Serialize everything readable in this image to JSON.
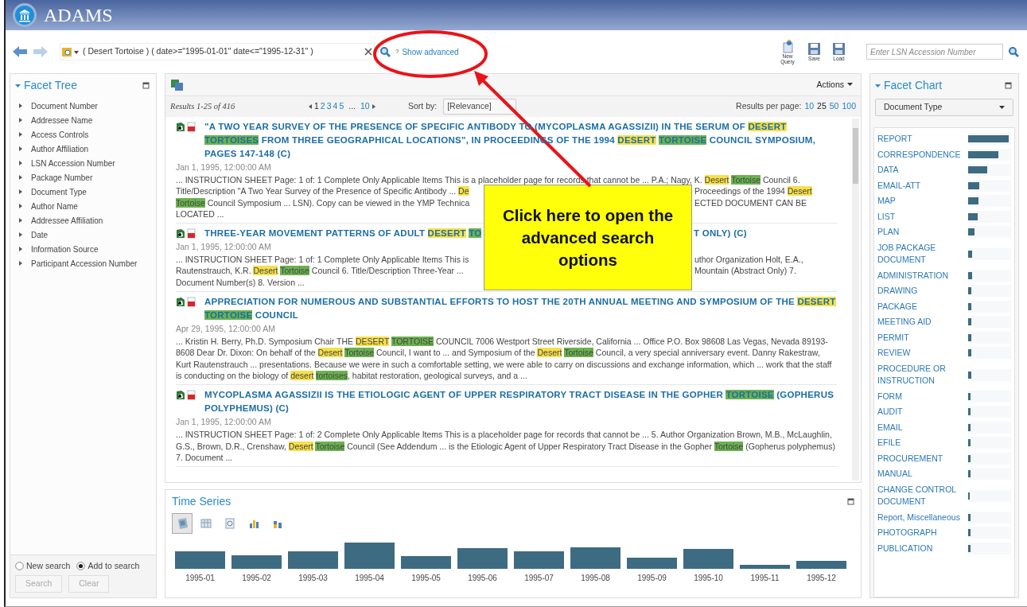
{
  "header": {
    "title": "ADAMS"
  },
  "toolbar": {
    "back_disabled": false,
    "forward_disabled": true,
    "query": "( Desert Tortoise ) ( date>=\"1995-01-01\" date<=\"1995-12-31\" )",
    "help": "?",
    "advanced_link": "Show advanced",
    "tools": [
      {
        "label": "New Query",
        "kind": "new"
      },
      {
        "label": "Save",
        "kind": "save"
      },
      {
        "label": "Load",
        "kind": "load"
      }
    ],
    "lsn_placeholder": "Enter LSN Accession Number"
  },
  "facet_tree": {
    "title": "Facet Tree",
    "items": [
      "Document Number",
      "Addressee Name",
      "Access Controls",
      "Author Affiliation",
      "LSN Accession Number",
      "Package Number",
      "Document Type",
      "Author Name",
      "Addressee Affiliation",
      "Date",
      "Information Source",
      "Participant Accession Number"
    ],
    "modes": [
      {
        "label": "New search",
        "selected": false
      },
      {
        "label": "Add to search",
        "selected": true
      }
    ],
    "buttons": [
      {
        "label": "Search",
        "disabled": true
      },
      {
        "label": "Clear",
        "disabled": true
      }
    ]
  },
  "results": {
    "actions": "Actions",
    "summary": "Results 1-25 of 416",
    "pages": [
      {
        "label": "1",
        "selected": true
      },
      {
        "label": "2",
        "selected": false
      },
      {
        "label": "3",
        "selected": false
      },
      {
        "label": "4",
        "selected": false
      },
      {
        "label": "5",
        "selected": false
      }
    ],
    "ellipsis": "...",
    "last_page": "10",
    "sort_label": "Sort by:",
    "sort_value": "[Relevance]",
    "per_page_label": "Results per page:",
    "per_page": [
      {
        "label": "10",
        "selected": false
      },
      {
        "label": "25",
        "selected": true
      },
      {
        "label": "50",
        "selected": false
      },
      {
        "label": "100",
        "selected": false
      }
    ],
    "items": [
      {
        "title": [
          [
            {
              "text": "\"A TWO YEAR SURVEY OF THE PRESENCE OF SPECIFIC ANTIBODY TO (MYCOPLASMA AGASSIZII) IN THE SERUM OF ",
              "kind": "plain"
            },
            {
              "text": "DESERT ",
              "kind": "term1"
            },
            {
              "text": "TORTOISES",
              "kind": "term2"
            },
            {
              "text": " FROM THREE GEOGRAPHICAL LOCATIONS\", IN PROCEEDINGS OF THE 1994 ",
              "kind": "plain"
            },
            {
              "text": "DESERT ",
              "kind": "term1"
            },
            {
              "text": "TORTOISE",
              "kind": "term2"
            },
            {
              "text": " COUNCIL SYMPOSIUM, PAGES 147-148 (C)",
              "kind": "plain"
            }
          ]
        ],
        "date": "Jan 1, 1995, 12:00:00 AM",
        "snippet": [
          [
            [
              {
                "text": "... INSTRUCTION SHEET Page: 1 of: 1 Complete Only Applicable Items This is a placeholder page for records that cannot be ... P.A.; Nagy, K. ",
                "kind": "plain"
              },
              {
                "text": "Desert ",
                "kind": "term1"
              },
              {
                "text": "Tortoise",
                "kind": "term2"
              },
              {
                "text": " Council 6.",
                "kind": "plain"
              }
            ]
          ],
          [
            [
              {
                "text": "Title/Description \"A Two Year Survey of the Presence of Specific Antibody ... ",
                "kind": "plain"
              },
              {
                "text": "De",
                "kind": "term1"
              }
            ],
            [
              {
                "text": "Proceedings of the 1994 ",
                "kind": "plain"
              },
              {
                "text": "Desert",
                "kind": "term1"
              }
            ]
          ],
          [
            [
              {
                "text": "Tortoise",
                "kind": "term2"
              },
              {
                "text": " Council Symposium ... LSN). Copy can be viewed in the YMP Technica",
                "kind": "plain"
              }
            ],
            [
              {
                "text": "ECTED DOCUMENT CAN BE",
                "kind": "plain"
              }
            ]
          ],
          [
            [
              {
                "text": "LOCATED ...",
                "kind": "plain"
              }
            ]
          ]
        ]
      },
      {
        "title": [
          [
            {
              "text": "THREE-YEAR MOVEMENT PATTERNS OF ADULT ",
              "kind": "plain"
            },
            {
              "text": "DESERT ",
              "kind": "term1"
            },
            {
              "text": "TO",
              "kind": "term2"
            }
          ],
          [
            {
              "text": "T ONLY) (C)",
              "kind": "plain"
            }
          ]
        ],
        "date": "Jan 1, 1995, 12:00:00 AM",
        "snippet": [
          [
            [
              {
                "text": "... INSTRUCTION SHEET Page: 1 of: 1 Complete Only Applicable Items This is",
                "kind": "plain"
              }
            ],
            [
              {
                "text": "uthor Organization Holt, E.A.,",
                "kind": "plain"
              }
            ]
          ],
          [
            [
              {
                "text": "Rautenstrauch, K.R. ",
                "kind": "plain"
              },
              {
                "text": "Desert ",
                "kind": "term1"
              },
              {
                "text": "Tortoise",
                "kind": "term2"
              },
              {
                "text": " Council 6. Title/Description Three-Year ...",
                "kind": "plain"
              }
            ],
            [
              {
                "text": "Mountain (Abstract Only) 7.",
                "kind": "plain"
              }
            ]
          ],
          [
            [
              {
                "text": "Document Number(s) 8. Version ...",
                "kind": "plain"
              }
            ]
          ]
        ]
      },
      {
        "title": [
          [
            {
              "text": "APPRECIATION FOR NUMEROUS AND SUBSTANTIAL EFFORTS TO HOST THE 20TH ANNUAL MEETING AND SYMPOSIUM OF THE ",
              "kind": "plain"
            },
            {
              "text": "DESERT ",
              "kind": "term1"
            },
            {
              "text": "TORTOISE",
              "kind": "term2"
            },
            {
              "text": " COUNCIL",
              "kind": "plain"
            }
          ]
        ],
        "date": "Apr 29, 1995, 12:00:00 AM",
        "snippet": [
          [
            [
              {
                "text": "... Kristin H. Berry, Ph.D. Symposium Chair THE ",
                "kind": "plain"
              },
              {
                "text": "DESERT ",
                "kind": "term1"
              },
              {
                "text": "TORTOISE",
                "kind": "term2"
              },
              {
                "text": " COUNCIL 7006 Westport Street Riverside, California ... Office P.O. Box 98608 Las Vegas, Nevada 89193-8608 Dear Dr. Dixon: On behalf of the ",
                "kind": "plain"
              },
              {
                "text": "Desert ",
                "kind": "term1"
              },
              {
                "text": "Tortoise",
                "kind": "term2"
              },
              {
                "text": " Council, I want to ... and Symposium of the ",
                "kind": "plain"
              },
              {
                "text": "Desert ",
                "kind": "term1"
              },
              {
                "text": "Tortoise",
                "kind": "term2"
              },
              {
                "text": " Council, a very special anniversary event. Danny Rakestraw, Kurt Rautenstrauch ... presentations. Because we were in such a comfortable setting, we were able to carry on discussions and exchange information, which ... work that the staff is conducting on the biology of ",
                "kind": "plain"
              },
              {
                "text": "desert ",
                "kind": "term1"
              },
              {
                "text": "tortoises",
                "kind": "term2"
              },
              {
                "text": ", habitat restoration, geological surveys, and a ...",
                "kind": "plain"
              }
            ]
          ]
        ]
      },
      {
        "title": [
          [
            {
              "text": "MYCOPLASMA AGASSIZII IS THE ETIOLOGIC AGENT OF UPPER RESPIRATORY TRACT DISEASE IN THE GOPHER ",
              "kind": "plain"
            },
            {
              "text": "TORTOISE",
              "kind": "term2"
            },
            {
              "text": " (GOPHERUS POLYPHEMUS) (C)",
              "kind": "plain"
            }
          ]
        ],
        "date": "Jan 1, 1995, 12:00:00 AM",
        "snippet": [
          [
            [
              {
                "text": "... INSTRUCTION SHEET Page: 1 of: 2 Complete Only Applicable Items This is a placeholder page for records that cannot be ... 5. Author Organization Brown, M.B., McLaughlin, G.S., Brown, D.R., Crenshaw, ",
                "kind": "plain"
              },
              {
                "text": "Desert ",
                "kind": "term1"
              },
              {
                "text": "Tortoise",
                "kind": "term2"
              },
              {
                "text": " Council (See Addendum ... is the Etiologic Agent of Upper Respiratory Tract Disease in the Gopher ",
                "kind": "plain"
              },
              {
                "text": "Tortoise",
                "kind": "term2"
              },
              {
                "text": " (Gopherus polyphemus) 7. Document ...",
                "kind": "plain"
              }
            ]
          ]
        ]
      }
    ]
  },
  "time_series": {
    "title": "Time Series",
    "views": [
      {
        "kind": "map",
        "selected": true
      },
      {
        "kind": "grid",
        "selected": false
      },
      {
        "kind": "page",
        "selected": false
      },
      {
        "kind": "bars",
        "selected": false
      },
      {
        "kind": "stacked",
        "selected": false
      }
    ],
    "labels": [
      "1995-01",
      "1995-02",
      "1995-03",
      "1995-04",
      "1995-05",
      "1995-06",
      "1995-07",
      "1995-08",
      "1995-09",
      "1995-10",
      "1995-11",
      "1995-12"
    ]
  },
  "facet_chart": {
    "title": "Facet Chart",
    "field": "Document Type",
    "bars": [
      {
        "label": "REPORT",
        "level": 1
      },
      {
        "label": "CORRESPONDENCE",
        "level": 0.75
      },
      {
        "label": "DATA",
        "level": 0.47
      },
      {
        "label": "EMAIL-ATT",
        "level": 0.27
      },
      {
        "label": "MAP",
        "level": 0.25
      },
      {
        "label": "LIST",
        "level": 0.23
      },
      {
        "label": "PLAN",
        "level": 0.16
      },
      {
        "label": "JOB PACKAGE DOCUMENT",
        "level": 0.1
      },
      {
        "label": "ADMINISTRATION",
        "level": 0.1
      },
      {
        "label": "DRAWING",
        "level": 0.08
      },
      {
        "label": "PACKAGE",
        "level": 0.08
      },
      {
        "label": "MEETING AID",
        "level": 0.08
      },
      {
        "label": "PERMIT",
        "level": 0.08
      },
      {
        "label": "REVIEW",
        "level": 0.08
      },
      {
        "label": "PROCEDURE OR INSTRUCTION",
        "level": 0.08
      },
      {
        "label": "FORM",
        "level": 0.05
      },
      {
        "label": "AUDIT",
        "level": 0.05
      },
      {
        "label": "EMAIL",
        "level": 0.05
      },
      {
        "label": "EFILE",
        "level": 0.05
      },
      {
        "label": "PROCUREMENT",
        "level": 0.05
      },
      {
        "label": "MANUAL",
        "level": 0.05
      },
      {
        "label": "CHANGE CONTROL DOCUMENT",
        "level": 0.04
      },
      {
        "label": "Report, Miscellaneous",
        "level": 0.05
      },
      {
        "label": "PHOTOGRAPH",
        "level": 0.05
      },
      {
        "label": "PUBLICATION",
        "level": 0.05
      }
    ]
  },
  "callout": {
    "text": "Click here to open the advanced search options"
  }
}
